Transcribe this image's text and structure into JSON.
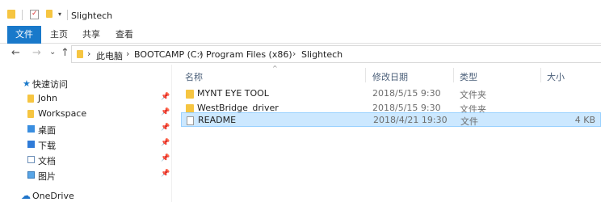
{
  "title_bar": {
    "title": "Slightech",
    "dropdown_glyph": "▾"
  },
  "ribbon": {
    "tabs": [
      {
        "label": "文件",
        "active": true
      },
      {
        "label": "主页"
      },
      {
        "label": "共享"
      },
      {
        "label": "查看"
      }
    ]
  },
  "nav": {
    "back_glyph": "←",
    "forward_glyph": "→",
    "recent_glyph": "⌄",
    "up_glyph": "↑"
  },
  "address": {
    "separator": "›",
    "crumbs": [
      "此电脑",
      "BOOTCAMP (C:)",
      "Program Files (x86)",
      "Slightech"
    ]
  },
  "navigation_pane": {
    "quick_access": {
      "label": "快速访问",
      "icon": "star-icon"
    },
    "items": [
      {
        "label": "John",
        "icon": "folder-icon",
        "pinned": true
      },
      {
        "label": "Workspace",
        "icon": "folder-icon",
        "pinned": true
      },
      {
        "label": "桌面",
        "icon": "desktop-icon",
        "pinned": true
      },
      {
        "label": "下载",
        "icon": "download-icon",
        "pinned": true
      },
      {
        "label": "文档",
        "icon": "documents-icon",
        "pinned": true
      },
      {
        "label": "图片",
        "icon": "pictures-icon",
        "pinned": true
      }
    ],
    "pin_glyph": "📌",
    "onedrive": {
      "label": "OneDrive",
      "icon": "cloud-icon"
    }
  },
  "columns": {
    "name": "名称",
    "date": "修改日期",
    "type": "类型",
    "size": "大小",
    "sort_glyph": "^"
  },
  "files": [
    {
      "name": "MYNT EYE TOOL",
      "date": "2018/5/15 9:30",
      "type": "文件夹",
      "size": "",
      "kind": "folder",
      "selected": false
    },
    {
      "name": "WestBridge_driver",
      "date": "2018/5/15 9:30",
      "type": "文件夹",
      "size": "",
      "kind": "folder",
      "selected": false
    },
    {
      "name": "README",
      "date": "2018/4/21 19:30",
      "type": "文件",
      "size": "4 KB",
      "kind": "file",
      "selected": true
    }
  ],
  "colors": {
    "accent": "#1979ca",
    "folder": "#f6c541",
    "selection": "#cce8ff",
    "selection_border": "#99d1ff"
  }
}
